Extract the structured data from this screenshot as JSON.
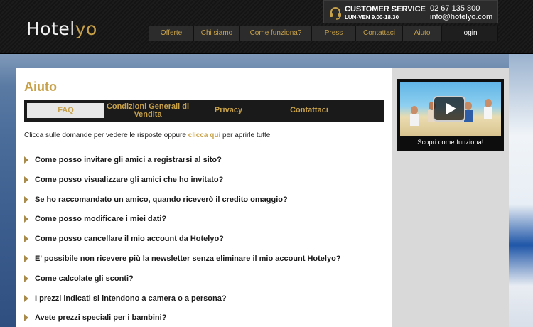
{
  "brand": {
    "part1": "Hotel",
    "part2": "yo",
    "accent": "#c8a24a"
  },
  "customer_service": {
    "title": "CUSTOMER SERVICE",
    "hours": "LUN-VEN 9.00-18.30",
    "phone": "02 67 135 800",
    "email": "info@hotelyo.com",
    "icon": "headset-icon"
  },
  "nav": [
    {
      "label": "Offerte"
    },
    {
      "label": "Chi siamo"
    },
    {
      "label": "Come funziona?"
    },
    {
      "label": "Press"
    },
    {
      "label": "Contattaci"
    },
    {
      "label": "Aiuto"
    },
    {
      "label": "login"
    }
  ],
  "page": {
    "title": "Aiuto",
    "tabs": [
      {
        "label": "FAQ",
        "active": true
      },
      {
        "label": "Condizioni Generali di Vendita",
        "active": false
      },
      {
        "label": "Privacy",
        "active": false
      },
      {
        "label": "Contattaci",
        "active": false
      }
    ],
    "intro_before": "Clicca sulle domande per vedere le risposte oppure ",
    "intro_link": "clicca qui",
    "intro_after": " per aprirle tutte",
    "questions": [
      "Come posso invitare gli amici a registrarsi al sito?",
      "Come posso visualizzare gli amici che ho invitato?",
      "Se ho raccomandato un amico, quando riceverò il credito omaggio?",
      "Come posso modificare i miei dati?",
      "Come posso cancellare il mio account da Hotelyo?",
      "E' possibile non ricevere più la newsletter senza eliminare il mio account Hotelyo?",
      "Come calcolate gli sconti?",
      "I prezzi indicati si intendono a camera o a persona?",
      "Avete prezzi speciali per i bambini?"
    ]
  },
  "promo": {
    "caption": "Scopri come funziona!",
    "icon": "play-icon"
  }
}
